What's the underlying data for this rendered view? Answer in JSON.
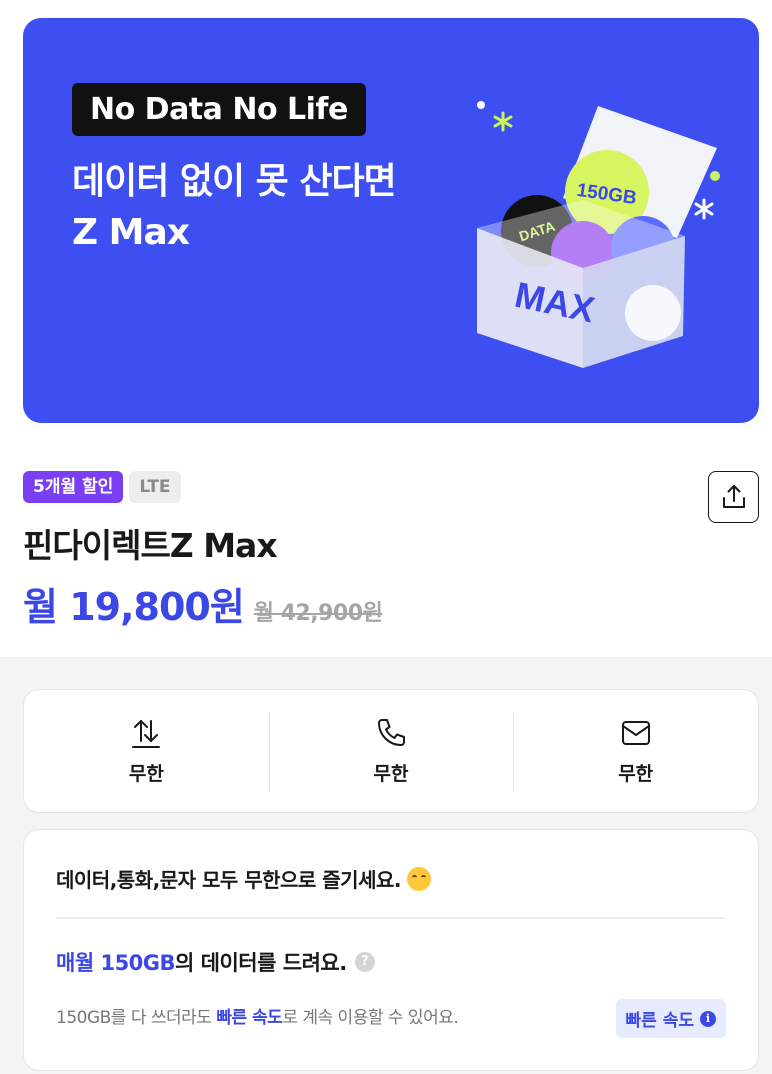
{
  "banner": {
    "badge": "No Data No Life",
    "title_line1": "데이터 없이 못 산다면",
    "title_line2": "Z Max",
    "art": {
      "box_label": "MAX",
      "bubble_gb": "150GB",
      "bubble_data": "DATA"
    }
  },
  "product": {
    "tags": {
      "discount": "5개월 할인",
      "network": "LTE"
    },
    "name": "핀다이렉트Z Max",
    "price": "월 19,800원",
    "original_price": "월 42,900원",
    "share_icon": "share-icon"
  },
  "features": [
    {
      "icon": "data-transfer-icon",
      "label": "무한"
    },
    {
      "icon": "phone-icon",
      "label": "무한"
    },
    {
      "icon": "mail-icon",
      "label": "무한"
    }
  ],
  "info": {
    "headline": "데이터,통화,문자 모두 무한으로 즐기세요.",
    "headline_emoji": "hugging-face-emoji",
    "data_highlight": "매월 150GB",
    "data_rest": "의 데이터를 드려요.",
    "desc_before": "150GB를 다 쓰더라도 ",
    "desc_highlight": "빠른 속도",
    "desc_after": "로 계속 이용할 수 있어요.",
    "speed_chip": "빠른 속도"
  },
  "colors": {
    "banner_bg": "#3d4ff0",
    "accent": "#3b48e6",
    "discount_tag": "#7b3ff2"
  }
}
